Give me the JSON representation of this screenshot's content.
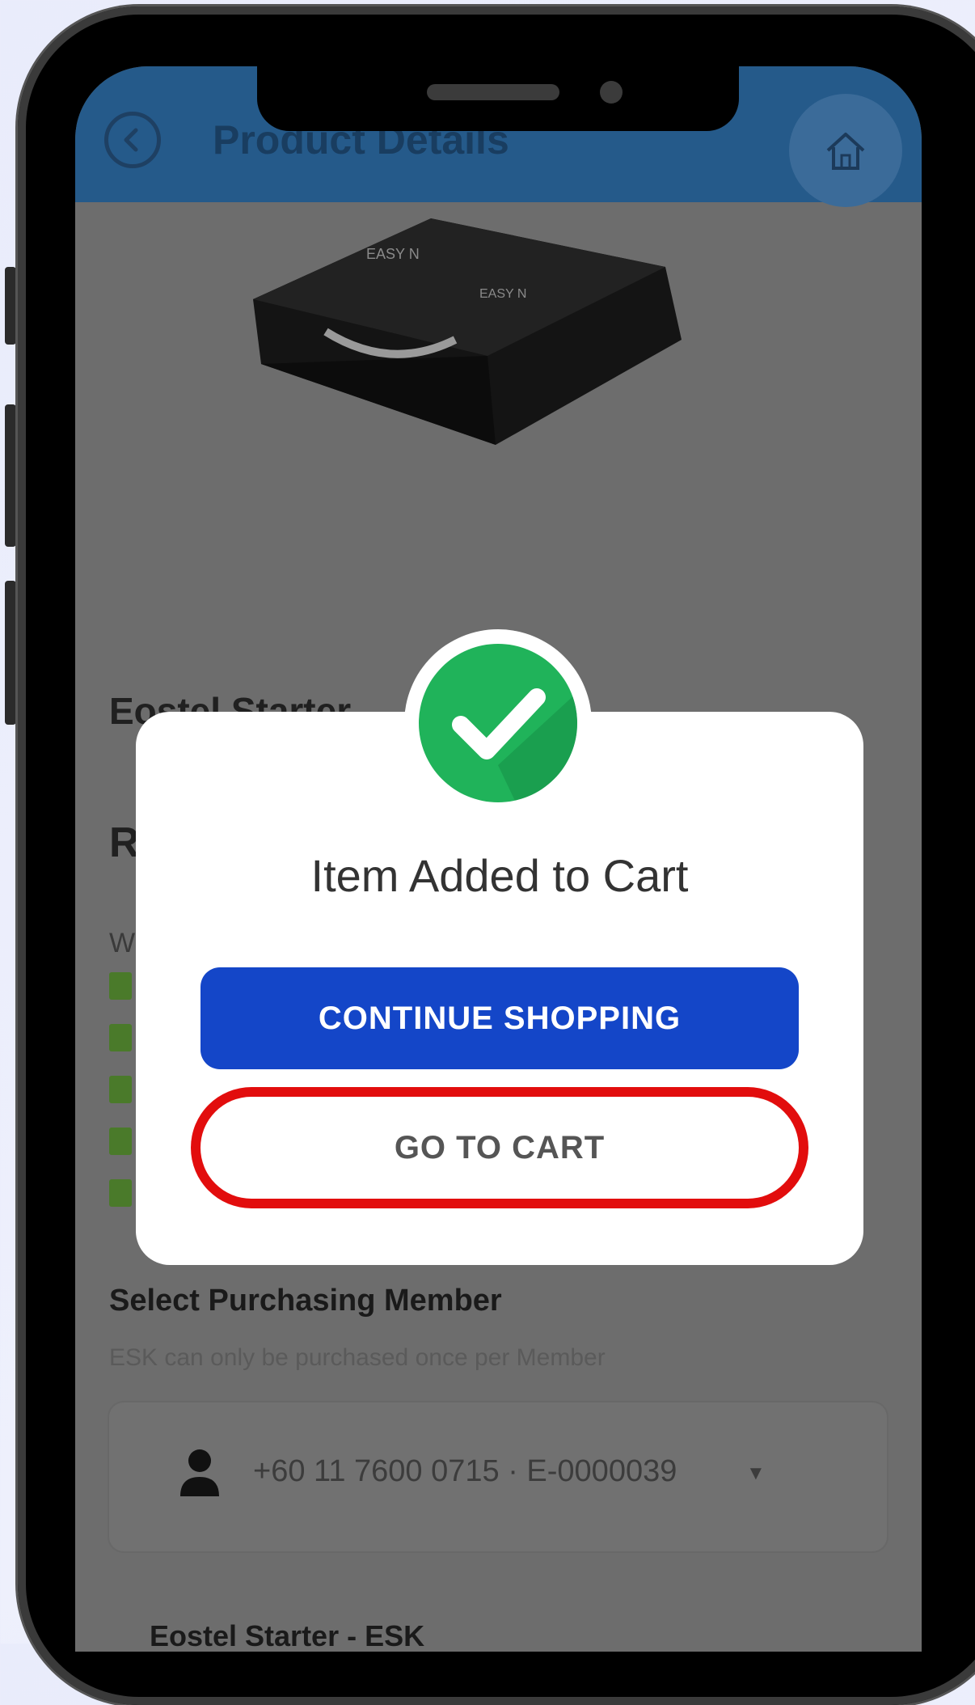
{
  "app_bar": {
    "title": "Product Details",
    "back_icon": "back-circle-icon",
    "home_icon": "home-icon"
  },
  "product": {
    "title": "Eostel Starter",
    "section_r": "R",
    "section_w": "W"
  },
  "purchasing": {
    "title": "Select Purchasing Member",
    "subtitle": "ESK can only be purchased once per Member",
    "member_value": "+60 11 7600 0715 · E-0000039"
  },
  "bottom": {
    "title": "Eostel Starter - ESK"
  },
  "modal": {
    "title": "Item Added to Cart",
    "continue_label": "CONTINUE SHOPPING",
    "cart_label": "GO TO CART"
  },
  "colors": {
    "primary_blue": "#1446c8",
    "success_green": "#20b35a",
    "highlight_red": "#e20d0d"
  }
}
